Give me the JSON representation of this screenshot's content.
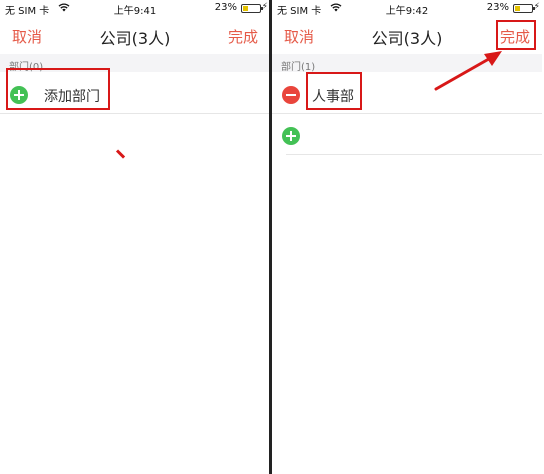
{
  "screens": [
    {
      "status_bar": {
        "carrier": "无 SIM 卡",
        "time": "上午9:41",
        "battery": "23%"
      },
      "nav": {
        "cancel": "取消",
        "title": "公司(3人)",
        "done": "完成"
      },
      "section_header": "部门(0)",
      "rows": [
        {
          "label": "添加部门",
          "icon": "plus-circle-icon"
        }
      ]
    },
    {
      "status_bar": {
        "carrier": "无 SIM 卡",
        "time": "上午9:42",
        "battery": "23%"
      },
      "nav": {
        "cancel": "取消",
        "title": "公司(3人)",
        "done": "完成"
      },
      "section_header": "部门(1)",
      "rows": [
        {
          "label": "人事部",
          "icon": "minus-circle-icon"
        },
        {
          "label": "",
          "icon": "plus-circle-icon"
        }
      ]
    }
  ],
  "colors": {
    "accent": "#e55a48",
    "add": "#43c155",
    "remove": "#e9453c",
    "annotation": "#d81818",
    "battery": "#e4c200"
  }
}
